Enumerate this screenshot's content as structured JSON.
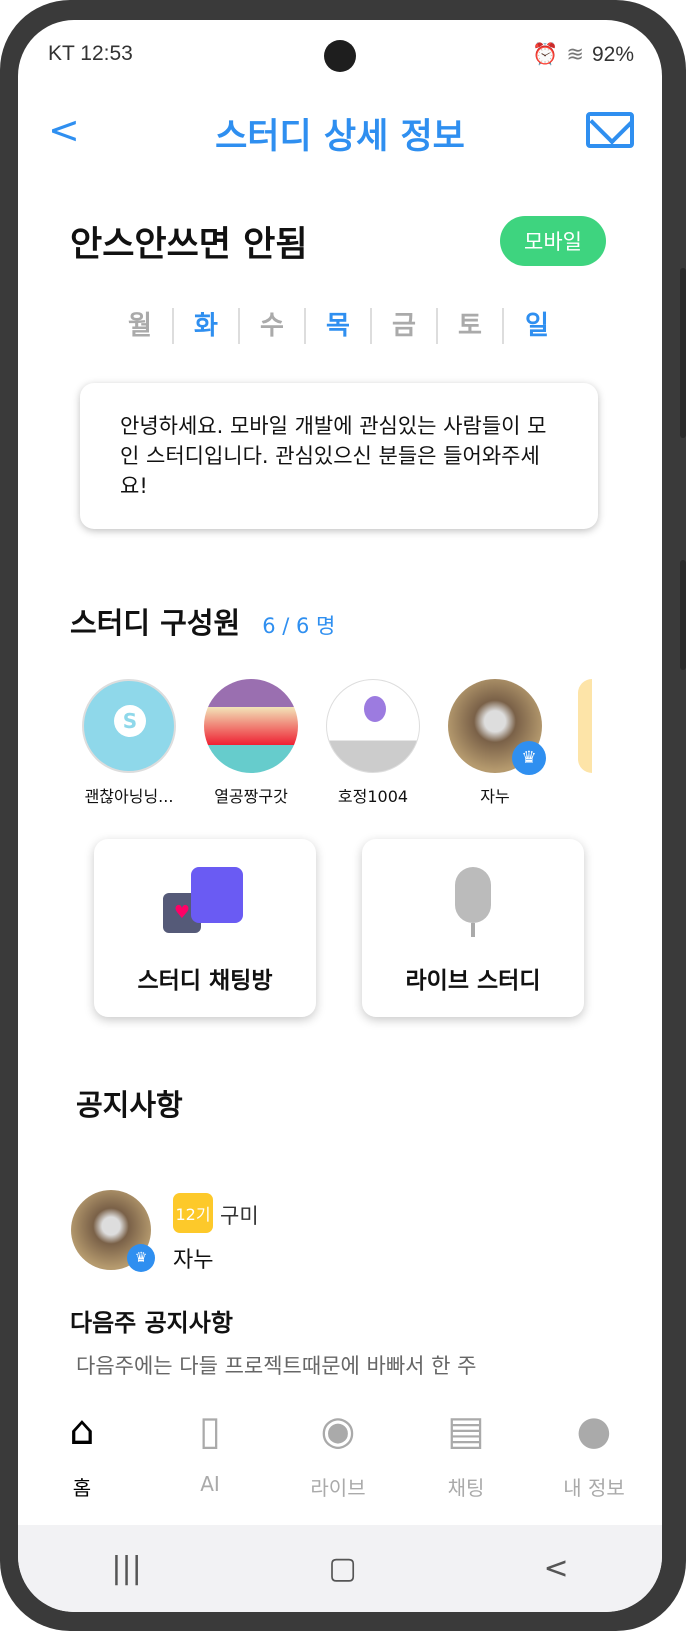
{
  "status_bar": {
    "carrier_time": "KT 12:53",
    "battery": "92%",
    "icons": [
      "screen-record-icon",
      "alarm-icon",
      "mute-icon",
      "wifi-icon",
      "hd-icon",
      "signal-icon",
      "battery-icon"
    ]
  },
  "header": {
    "title": "스터디 상세 정보",
    "back_icon": "chevron-left-icon",
    "mail_icon": "mail-icon"
  },
  "study": {
    "name": "안스안쓰면 안됨",
    "category": "모바일",
    "days": [
      {
        "label": "월",
        "active": false
      },
      {
        "label": "화",
        "active": true
      },
      {
        "label": "수",
        "active": false
      },
      {
        "label": "목",
        "active": true
      },
      {
        "label": "금",
        "active": false
      },
      {
        "label": "토",
        "active": false
      },
      {
        "label": "일",
        "active": true
      }
    ],
    "description": "안녕하세요. 모바일 개발에 관심있는 사람들이 모인 스터디입니다. 관심있으신 분들은 들어와주세요!"
  },
  "members": {
    "title": "스터디 구성원",
    "count": "6 / 6 명",
    "items": [
      {
        "name": "괜찮아닝닝..."
      },
      {
        "name": "열공짱구갓"
      },
      {
        "name": "호정1004"
      },
      {
        "name": "자누",
        "leader": true
      }
    ]
  },
  "actions": {
    "chat": "스터디 채팅방",
    "live": "라이브 스터디"
  },
  "notice": {
    "title": "공지사항",
    "badge": "12기",
    "region": "구미",
    "author": "자누",
    "post_title": "다음주 공지사항",
    "post_preview": "다음주에는 다들 프로젝트때문에 바빠서 한 주"
  },
  "tabs": [
    {
      "label": "홈",
      "icon": "home-icon",
      "active": true
    },
    {
      "label": "AI",
      "icon": "clip-file-icon"
    },
    {
      "label": "라이브",
      "icon": "broadcast-icon"
    },
    {
      "label": "채팅",
      "icon": "chat-icon"
    },
    {
      "label": "내 정보",
      "icon": "person-icon"
    }
  ],
  "colors": {
    "accent": "#2f8ff0",
    "badge_green": "#3ed47f",
    "badge_yellow": "#fdc92a"
  }
}
